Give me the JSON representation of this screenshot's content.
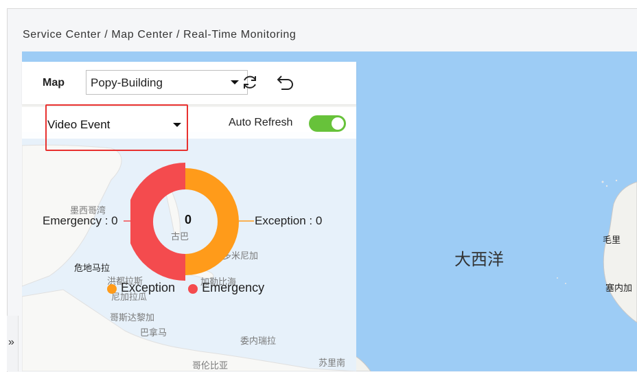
{
  "breadcrumb": "Service Center / Map Center / Real-Time Monitoring",
  "toolbar": {
    "map_label": "Map",
    "map_selected": "Popy-Building",
    "refresh_icon": "refresh-icon",
    "undo_icon": "undo-icon"
  },
  "event_filter": {
    "selected": "Video Event",
    "auto_refresh_label": "Auto Refresh",
    "auto_refresh_on": true
  },
  "chart_data": {
    "type": "pie",
    "center_value": "0",
    "slices": [
      {
        "name": "Exception",
        "value": 0,
        "color": "#ff9b1a"
      },
      {
        "name": "Emergency",
        "value": 0,
        "color": "#f44b4e"
      }
    ],
    "labels": {
      "exception": "Exception : 0",
      "emergency": "Emergency : 0"
    },
    "legend": [
      "Exception",
      "Emergency"
    ]
  },
  "map_labels": {
    "ocean": "大西洋",
    "gulf_of_mexico": "墨西哥湾",
    "cuba": "古巴",
    "dominican": "多米尼加",
    "guatemala": "危地马拉",
    "honduras": "洪都拉斯",
    "nicaragua": "尼加拉瓜",
    "caribbean": "加勒比海",
    "costa_rica": "哥斯达黎加",
    "panama": "巴拿马",
    "venezuela": "委内瑞拉",
    "colombia": "哥伦比亚",
    "suriname": "苏里南",
    "mauritania": "毛里",
    "senegal": "塞内加"
  },
  "colors": {
    "accent_red": "#e8312f",
    "toggle_green": "#67c23a",
    "ocean": "#9dccf5"
  },
  "expand_icon": "double-chevron-right-icon",
  "expand_glyph": "»"
}
